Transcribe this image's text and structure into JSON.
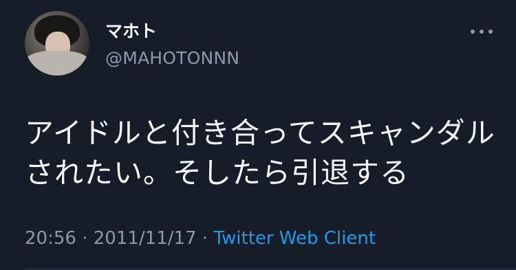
{
  "user": {
    "display_name": "マホト",
    "handle": "@MAHOTONNN"
  },
  "tweet": {
    "lines": [
      "アイドルと付き合ってスキャンダル",
      "されたい。そしたら引退する"
    ],
    "time": "20:56",
    "separator": "·",
    "date": "2011/11/17",
    "source": "Twitter Web Client"
  },
  "icons": {
    "more": "more-horizontal-icon"
  },
  "colors": {
    "background": "#161d28",
    "text_primary": "#f5f8fa",
    "text_secondary": "#8d99a6",
    "link": "#1d9bf0"
  }
}
